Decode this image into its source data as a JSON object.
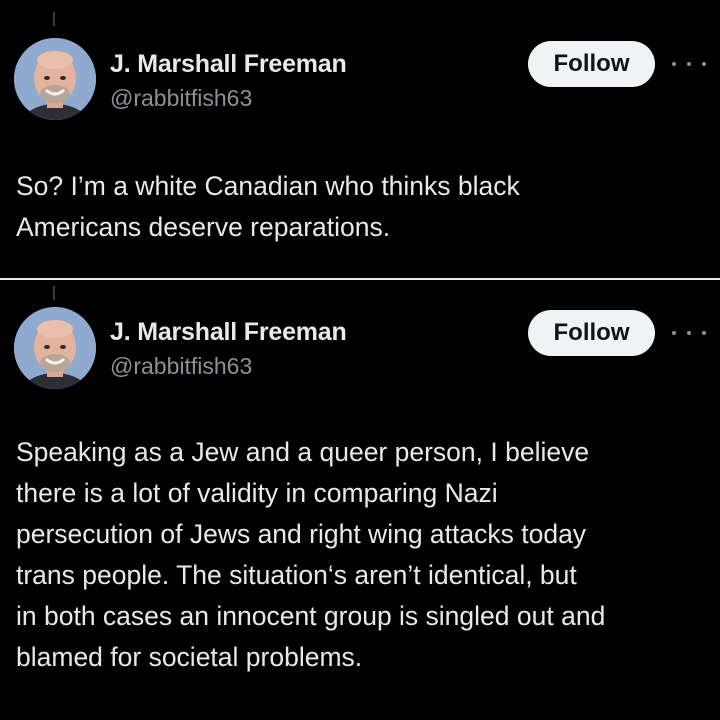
{
  "tweets": [
    {
      "author_name": "J. Marshall Freeman",
      "author_handle": "@rabbitfish63",
      "follow_label": "Follow",
      "avatar_icon": "avatar-photo",
      "more_icon": "more-options-icon",
      "text": "So? I’m a white Canadian who thinks black\nAmericans deserve reparations."
    },
    {
      "author_name": "J. Marshall Freeman",
      "author_handle": "@rabbitfish63",
      "follow_label": "Follow",
      "avatar_icon": "avatar-photo",
      "more_icon": "more-options-icon",
      "text": "Speaking as a Jew and a queer person, I believe\nthere is a lot of validity in comparing Nazi\npersecution of Jews and right wing attacks today\ntrans people. The situation‘s aren’t identical, but\nin both cases an innocent group is singled out and\nblamed for societal problems."
    }
  ],
  "colors": {
    "background": "#000000",
    "text_primary": "#e7e9ea",
    "text_secondary": "#8b9197",
    "follow_button_bg": "#eff3f4",
    "divider": "#e8e8e8"
  }
}
